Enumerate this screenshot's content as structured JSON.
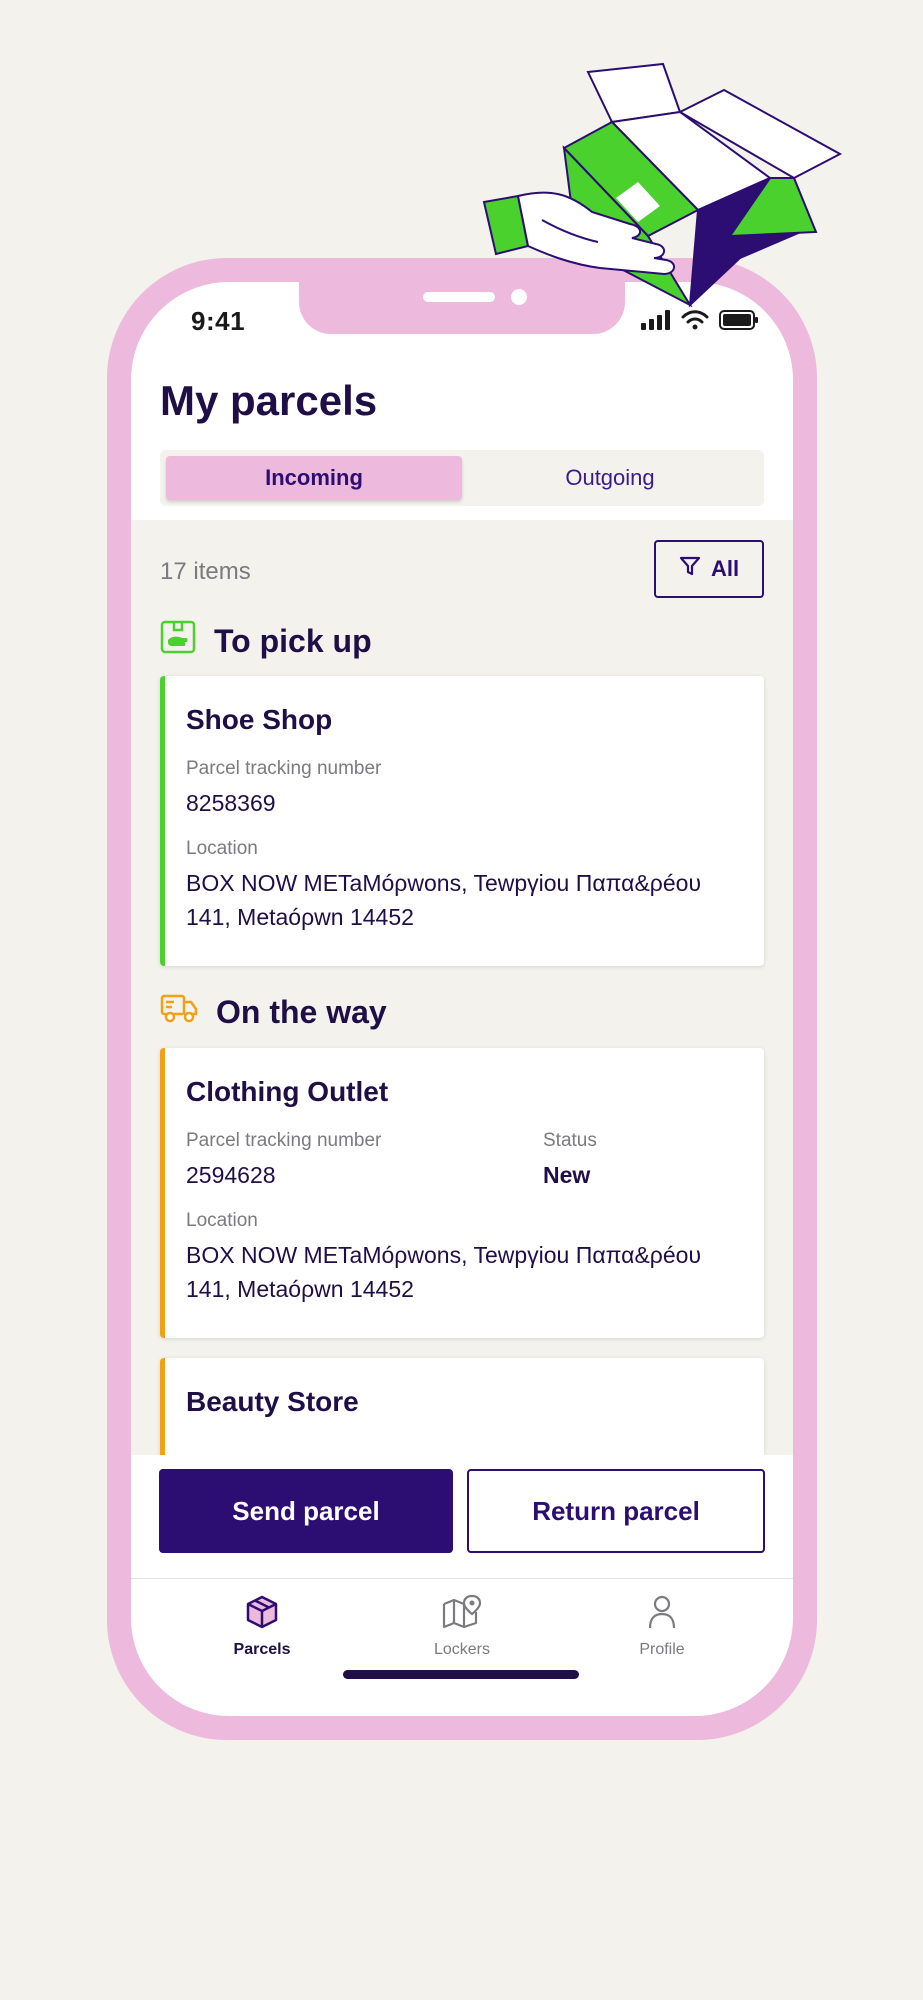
{
  "status_bar": {
    "time": "9:41"
  },
  "header": {
    "title": "My parcels",
    "tabs": [
      {
        "label": "Incoming",
        "active": true
      },
      {
        "label": "Outgoing",
        "active": false
      }
    ]
  },
  "list": {
    "count": "17 items",
    "filter_label": "All"
  },
  "sections": [
    {
      "title": "To pick up",
      "icon": "pickup-box-icon",
      "accent": "#4AD12E",
      "cards": [
        {
          "title": "Shoe Shop",
          "tracking_label": "Parcel tracking number",
          "tracking_number": "8258369",
          "location_label": "Location",
          "location": "BOX NOW METaMóρwons, Tewpγiou Παπα&ρéου 141, Metaóρwn 14452"
        }
      ]
    },
    {
      "title": "On the way",
      "icon": "delivery-truck-icon",
      "accent": "#F2A016",
      "cards": [
        {
          "title": "Clothing Outlet",
          "tracking_label": "Parcel tracking number",
          "tracking_number": "2594628",
          "status_label": "Status",
          "status": "New",
          "location_label": "Location",
          "location": "BOX NOW METaMóρwons, Tewpγiou Παπα&ρéου 141, Metaóρwn 14452"
        },
        {
          "title": "Beauty Store"
        }
      ]
    }
  ],
  "actions": {
    "send_label": "Send parcel",
    "return_label": "Return parcel"
  },
  "tabbar": {
    "items": [
      {
        "label": "Parcels",
        "icon": "parcel-box-icon",
        "active": true
      },
      {
        "label": "Lockers",
        "icon": "map-pin-icon",
        "active": false
      },
      {
        "label": "Profile",
        "icon": "person-icon",
        "active": false
      }
    ]
  },
  "colors": {
    "brand_dark": "#2C0D72",
    "brand_pink": "#EDBADE",
    "brand_green": "#4AD12E",
    "accent_orange": "#F2A016",
    "background": "#F3F2EC"
  }
}
